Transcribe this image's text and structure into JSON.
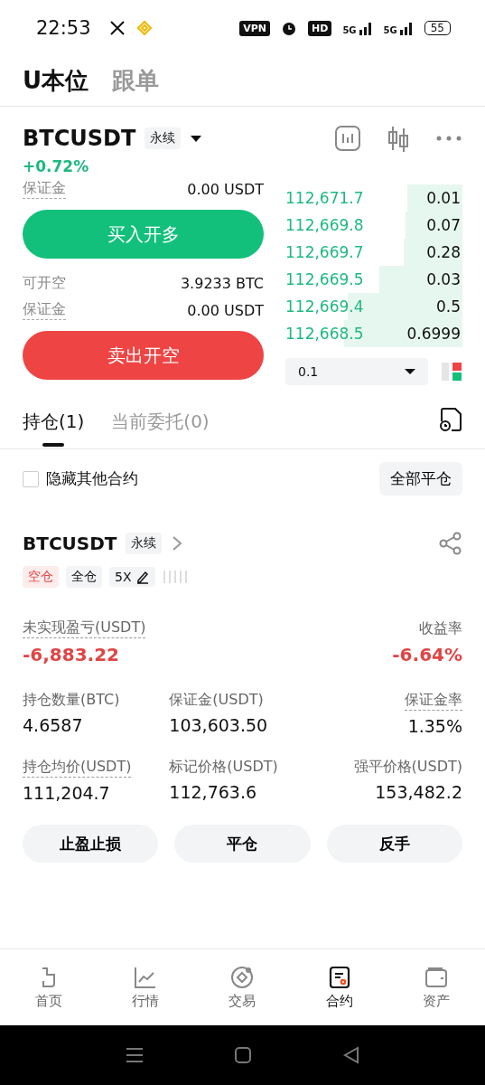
{
  "status_bar": {
    "time": "22:53",
    "vpn": "VPN",
    "hd": "HD",
    "networks": [
      "5G",
      "5G"
    ],
    "battery": "55"
  },
  "header_tabs": [
    {
      "label": "U本位",
      "selected": true
    },
    {
      "label": "跟单",
      "selected": false
    }
  ],
  "symbol": {
    "name": "BTCUSDT",
    "tag": "永续",
    "change": "+0.72%"
  },
  "order_form": {
    "rows_top": [
      {
        "label": "保证金",
        "value": "0.00 USDT",
        "hint": true
      }
    ],
    "buy_button": "买入开多",
    "rows_bottom": [
      {
        "label": "可开空",
        "value": "3.9233 BTC",
        "hint": false
      },
      {
        "label": "保证金",
        "value": "0.00 USDT",
        "hint": true
      }
    ],
    "sell_button": "卖出开空"
  },
  "order_book": {
    "rows": [
      {
        "price": "112,671.7",
        "amount": "0.01"
      },
      {
        "price": "112,669.8",
        "amount": "0.07"
      },
      {
        "price": "112,669.7",
        "amount": "0.28"
      },
      {
        "price": "112,669.5",
        "amount": "0.03"
      },
      {
        "price": "112,669.4",
        "amount": "0.5"
      },
      {
        "price": "112,668.5",
        "amount": "0.6999"
      }
    ],
    "precision": "0.1"
  },
  "position_tabs": [
    {
      "label": "持仓(1)",
      "selected": true
    },
    {
      "label": "当前委托(0)",
      "selected": false
    }
  ],
  "hide_others": {
    "label": "隐藏其他合约",
    "checked": false
  },
  "close_all_button": "全部平仓",
  "position": {
    "symbol": "BTCUSDT",
    "tag": "永续",
    "badges": [
      {
        "label": "空仓",
        "kind": "short"
      },
      {
        "label": "全仓",
        "kind": "plain"
      },
      {
        "label": "5X",
        "kind": "leverage"
      }
    ],
    "pnl": {
      "label": "未实现盈亏(USDT)",
      "value": "-6,883.22"
    },
    "roe": {
      "label": "收益率",
      "value": "-6.64%"
    },
    "stats": [
      {
        "label": "持仓数量(BTC)",
        "value": "4.6587",
        "hint": false
      },
      {
        "label": "保证金(USDT)",
        "value": "103,603.50",
        "hint": false
      },
      {
        "label": "保证金率",
        "value": "1.35%",
        "hint": true
      },
      {
        "label": "持仓均价(USDT)",
        "value": "111,204.7",
        "hint": true
      },
      {
        "label": "标记价格(USDT)",
        "value": "112,763.6",
        "hint": false
      },
      {
        "label": "强平价格(USDT)",
        "value": "153,482.2",
        "hint": false
      }
    ],
    "actions": [
      "止盈止损",
      "平仓",
      "反手"
    ]
  },
  "bottom_nav": [
    {
      "label": "首页",
      "kind": "home",
      "selected": false
    },
    {
      "label": "行情",
      "kind": "market",
      "selected": false
    },
    {
      "label": "交易",
      "kind": "trade",
      "selected": false
    },
    {
      "label": "合约",
      "kind": "futures",
      "selected": true
    },
    {
      "label": "资产",
      "kind": "assets",
      "selected": false
    }
  ]
}
